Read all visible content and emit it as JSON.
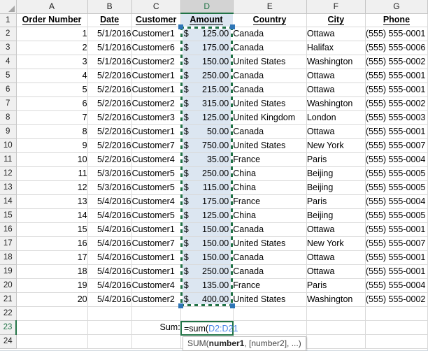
{
  "grid": {
    "corner_icon": "select-all-triangle-icon",
    "column_letters": [
      "A",
      "B",
      "C",
      "D",
      "E",
      "F",
      "G"
    ],
    "selected_column": "D",
    "row_numbers": [
      "1",
      "2",
      "3",
      "4",
      "5",
      "6",
      "7",
      "8",
      "9",
      "10",
      "11",
      "12",
      "13",
      "14",
      "15",
      "16",
      "17",
      "18",
      "19",
      "20",
      "21",
      "22",
      "23",
      "24"
    ],
    "active_row": "23"
  },
  "headers": {
    "order_number": "Order Number",
    "date": "Date",
    "customer": "Customer",
    "amount": "Amount",
    "country": "Country",
    "city": "City",
    "phone": "Phone"
  },
  "rows": [
    {
      "order": "1",
      "date": "5/1/2016",
      "customer": "Customer1",
      "currency": "$",
      "amount": "125.00",
      "country": "Canada",
      "city": "Ottawa",
      "phone": "(555) 555-0001"
    },
    {
      "order": "2",
      "date": "5/1/2016",
      "customer": "Customer6",
      "currency": "$",
      "amount": "175.00",
      "country": "Canada",
      "city": "Halifax",
      "phone": "(555) 555-0006"
    },
    {
      "order": "3",
      "date": "5/1/2016",
      "customer": "Customer2",
      "currency": "$",
      "amount": "150.00",
      "country": "United States",
      "city": "Washington",
      "phone": "(555) 555-0002"
    },
    {
      "order": "4",
      "date": "5/2/2016",
      "customer": "Customer1",
      "currency": "$",
      "amount": "250.00",
      "country": "Canada",
      "city": "Ottawa",
      "phone": "(555) 555-0001"
    },
    {
      "order": "5",
      "date": "5/2/2016",
      "customer": "Customer1",
      "currency": "$",
      "amount": "215.00",
      "country": "Canada",
      "city": "Ottawa",
      "phone": "(555) 555-0001"
    },
    {
      "order": "6",
      "date": "5/2/2016",
      "customer": "Customer2",
      "currency": "$",
      "amount": "315.00",
      "country": "United States",
      "city": "Washington",
      "phone": "(555) 555-0002"
    },
    {
      "order": "7",
      "date": "5/2/2016",
      "customer": "Customer3",
      "currency": "$",
      "amount": "125.00",
      "country": "United Kingdom",
      "city": "London",
      "phone": "(555) 555-0003"
    },
    {
      "order": "8",
      "date": "5/2/2016",
      "customer": "Customer1",
      "currency": "$",
      "amount": "50.00",
      "country": "Canada",
      "city": "Ottawa",
      "phone": "(555) 555-0001"
    },
    {
      "order": "9",
      "date": "5/2/2016",
      "customer": "Customer7",
      "currency": "$",
      "amount": "750.00",
      "country": "United States",
      "city": "New York",
      "phone": "(555) 555-0007"
    },
    {
      "order": "10",
      "date": "5/2/2016",
      "customer": "Customer4",
      "currency": "$",
      "amount": "35.00",
      "country": "France",
      "city": "Paris",
      "phone": "(555) 555-0004"
    },
    {
      "order": "11",
      "date": "5/3/2016",
      "customer": "Customer5",
      "currency": "$",
      "amount": "250.00",
      "country": "China",
      "city": "Beijing",
      "phone": "(555) 555-0005"
    },
    {
      "order": "12",
      "date": "5/3/2016",
      "customer": "Customer5",
      "currency": "$",
      "amount": "115.00",
      "country": "China",
      "city": "Beijing",
      "phone": "(555) 555-0005"
    },
    {
      "order": "13",
      "date": "5/4/2016",
      "customer": "Customer4",
      "currency": "$",
      "amount": "175.00",
      "country": "France",
      "city": "Paris",
      "phone": "(555) 555-0004"
    },
    {
      "order": "14",
      "date": "5/4/2016",
      "customer": "Customer5",
      "currency": "$",
      "amount": "125.00",
      "country": "China",
      "city": "Beijing",
      "phone": "(555) 555-0005"
    },
    {
      "order": "15",
      "date": "5/4/2016",
      "customer": "Customer1",
      "currency": "$",
      "amount": "150.00",
      "country": "Canada",
      "city": "Ottawa",
      "phone": "(555) 555-0001"
    },
    {
      "order": "16",
      "date": "5/4/2016",
      "customer": "Customer7",
      "currency": "$",
      "amount": "150.00",
      "country": "United States",
      "city": "New York",
      "phone": "(555) 555-0007"
    },
    {
      "order": "17",
      "date": "5/4/2016",
      "customer": "Customer1",
      "currency": "$",
      "amount": "150.00",
      "country": "Canada",
      "city": "Ottawa",
      "phone": "(555) 555-0001"
    },
    {
      "order": "18",
      "date": "5/4/2016",
      "customer": "Customer1",
      "currency": "$",
      "amount": "250.00",
      "country": "Canada",
      "city": "Ottawa",
      "phone": "(555) 555-0001"
    },
    {
      "order": "19",
      "date": "5/4/2016",
      "customer": "Customer4",
      "currency": "$",
      "amount": "135.00",
      "country": "France",
      "city": "Paris",
      "phone": "(555) 555-0004"
    },
    {
      "order": "20",
      "date": "5/4/2016",
      "customer": "Customer2",
      "currency": "$",
      "amount": "400.00",
      "country": "United States",
      "city": "Washington",
      "phone": "(555) 555-0002"
    }
  ],
  "sum_row": {
    "label": "Sum:",
    "formula_text": "=sum(",
    "formula_ref": "D2:D21"
  },
  "tooltip": {
    "prefix": "SUM(",
    "arg1": "number1",
    "suffix": ", [number2], ...)"
  },
  "colors": {
    "selection_green": "#217346",
    "handle_blue": "#2e75b6",
    "amount_fill": "#dce6f1",
    "formula_ref_blue": "#4a86e8",
    "header_gray": "#f0f0f0"
  }
}
